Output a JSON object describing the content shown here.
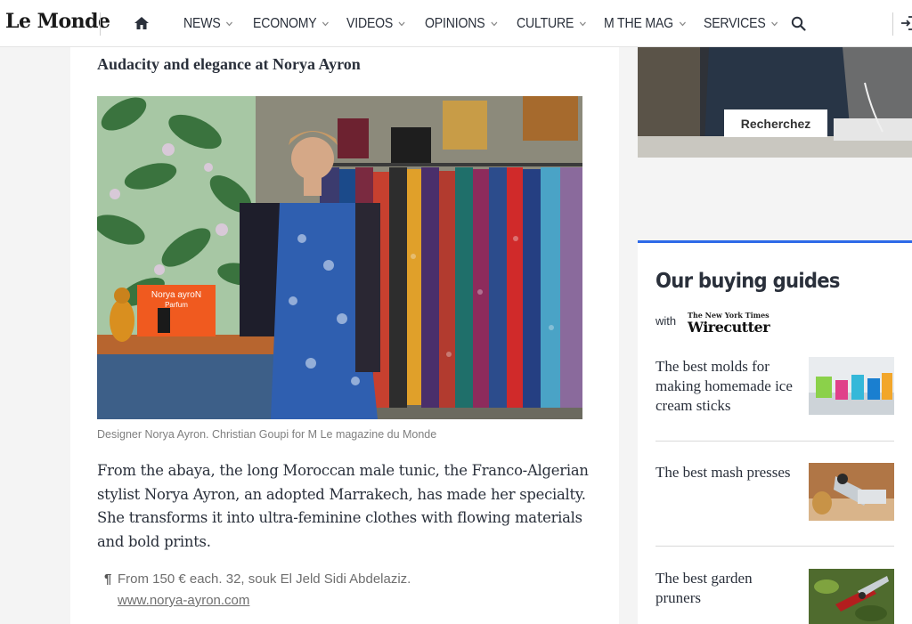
{
  "header": {
    "logo": "Le Monde",
    "nav": [
      {
        "label": "NEWS",
        "has_dropdown": true
      },
      {
        "label": "ECONOMY",
        "has_dropdown": true
      },
      {
        "label": "VIDEOS",
        "has_dropdown": true
      },
      {
        "label": "OPINIONS",
        "has_dropdown": true
      },
      {
        "label": "CULTURE",
        "has_dropdown": true
      },
      {
        "label": "M THE MAG",
        "has_dropdown": true
      },
      {
        "label": "SERVICES",
        "has_dropdown": true
      }
    ],
    "icons": [
      "home-icon",
      "search-icon",
      "login-icon"
    ]
  },
  "article": {
    "section_title": "Audacity and elegance at Norya Ayron",
    "photo_caption": "Designer Norya Ayron. Christian Goupi for M Le magazine du Monde",
    "photo_sign": {
      "line1": "Norya ayroN",
      "line2": "Parfum"
    },
    "body": "From the abaya, the long Moroccan male tunic, the Franco-Algerian stylist Norya Ayron, an adopted Marrakech, has made her specialty. She transforms it into ultra-feminine clothes with flowing materials and bold prints.",
    "info": {
      "pilcrow": "¶",
      "details": "From 150 € each. 32, souk El Jeld Sidi Abdelaziz.",
      "link": "www.norya-ayron.com"
    }
  },
  "ad": {
    "button_label": "Recherchez"
  },
  "buying_guides": {
    "title": "Our buying guides",
    "with_label": "with",
    "partner_top": "The New York Times",
    "partner_name": "Wirecutter",
    "items": [
      {
        "title": "The best molds for making homemade ice cream sticks"
      },
      {
        "title": "The best mash presses"
      },
      {
        "title": "The best garden pruners"
      }
    ]
  },
  "colors": {
    "accent_blue": "#2e6ae8",
    "text": "#2a303b",
    "caption_gray": "#7f7f7f",
    "page_bg": "#f4f4f4"
  }
}
